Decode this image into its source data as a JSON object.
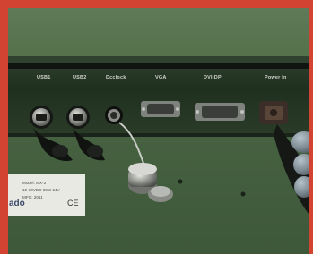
{
  "photo": {
    "port_labels": {
      "usb1": "USB1",
      "usb2": "USB2",
      "decclock": "Dcclock",
      "vga": "VGA",
      "dvi_dp": "DVI-DP",
      "power_in": "Power In"
    },
    "tag_lines": [
      "Model: MX-3",
      "12-30VDC 60W 24V",
      "MFG: 2011"
    ],
    "logo_text": "ado",
    "ce_mark": "CE",
    "colors": {
      "frame": "#d24331",
      "panel_green": "#4f6a45",
      "shadow_strip": "#111511"
    }
  }
}
